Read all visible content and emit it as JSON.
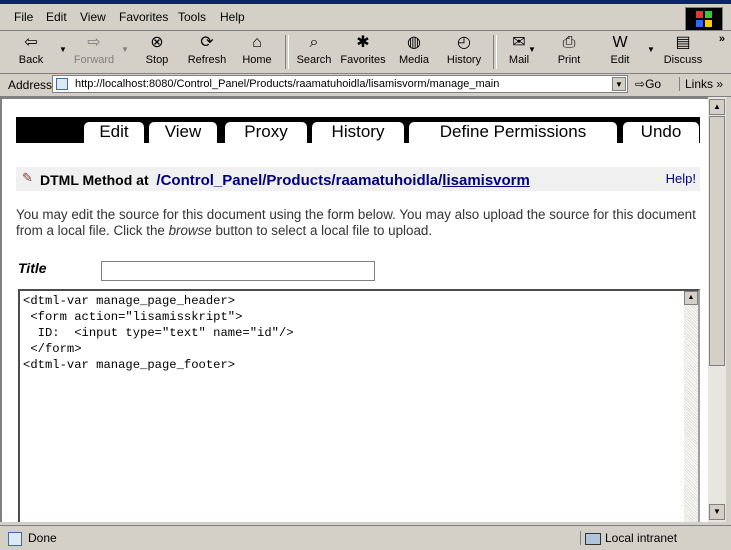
{
  "menu": {
    "items": [
      "File",
      "Edit",
      "View",
      "Favorites",
      "Tools",
      "Help"
    ]
  },
  "toolbar": {
    "buttons": [
      {
        "label": "Back",
        "icon": "back-arrow-icon"
      },
      {
        "label": "Forward",
        "icon": "forward-arrow-icon"
      },
      {
        "label": "Stop",
        "icon": "stop-icon"
      },
      {
        "label": "Refresh",
        "icon": "refresh-icon"
      },
      {
        "label": "Home",
        "icon": "home-icon"
      },
      {
        "label": "Search",
        "icon": "search-icon"
      },
      {
        "label": "Favorites",
        "icon": "favorites-icon"
      },
      {
        "label": "Media",
        "icon": "media-icon"
      },
      {
        "label": "History",
        "icon": "history-icon"
      },
      {
        "label": "Mail",
        "icon": "mail-icon"
      },
      {
        "label": "Print",
        "icon": "print-icon"
      },
      {
        "label": "Edit",
        "icon": "edit-icon"
      },
      {
        "label": "Discuss",
        "icon": "discuss-icon"
      }
    ],
    "more": "»"
  },
  "address": {
    "label": "Address",
    "url": "http://localhost:8080/Control_Panel/Products/raamatuhoidla/lisamisvorm/manage_main",
    "go": "Go",
    "links": "Links",
    "links_more": "»"
  },
  "zmi": {
    "tabs": [
      "Edit",
      "View",
      "Proxy",
      "History",
      "Define Permissions",
      "Undo"
    ],
    "object_type": "DTML Method at",
    "path_prefix": "/Control_Panel/Products/raamatuhoidla/",
    "path_current": "lisamisvorm",
    "help": "Help!",
    "description_1": "You may edit the source for this document using the form below. You may also upload the source for this document from a local file. Click the ",
    "description_em": "browse",
    "description_2": " button to select a local file to upload.",
    "title_label": "Title",
    "title_value": "",
    "source": "<dtml-var manage_page_header>\n <form action=\"lisamisskript\">\n  ID:  <input type=\"text\" name=\"id\"/>\n </form>\n<dtml-var manage_page_footer>"
  },
  "status": {
    "text": "Done",
    "zone": "Local intranet"
  }
}
